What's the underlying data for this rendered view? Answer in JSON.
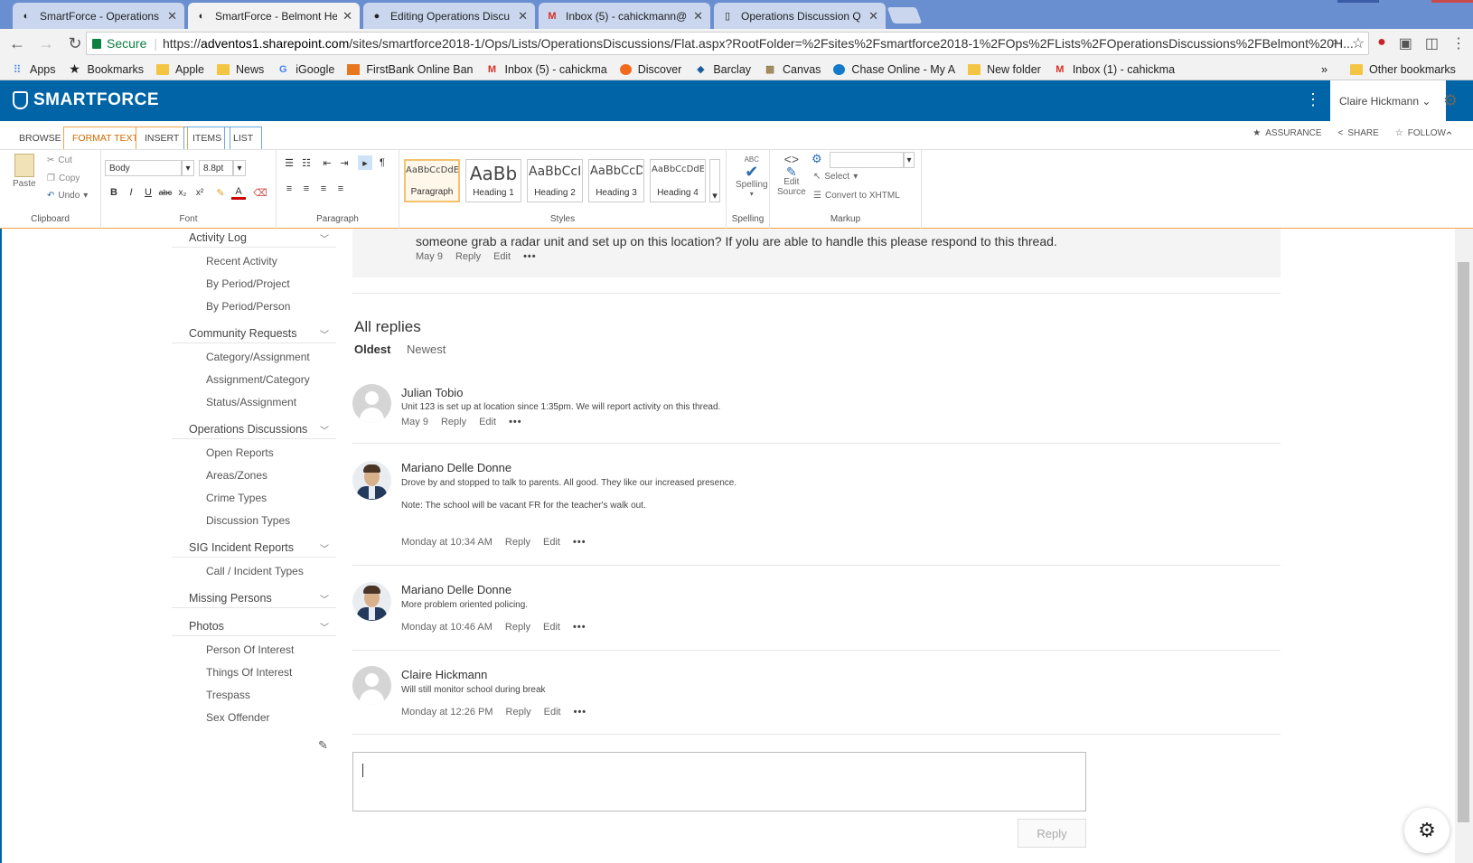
{
  "browser": {
    "tabs": [
      {
        "title": "SmartForce - Operations",
        "icon": "smartforce-icon"
      },
      {
        "title": "SmartForce - Belmont He",
        "icon": "smartforce-icon",
        "active": true
      },
      {
        "title": "Editing Operations Discu",
        "icon": "github-icon"
      },
      {
        "title": "Inbox (5) - cahickmann@",
        "icon": "gmail-icon"
      },
      {
        "title": "Operations Discussion Q",
        "icon": "document-icon"
      }
    ],
    "secure_label": "Secure",
    "url_prefix": "https://",
    "url_host": "adventos1.sharepoint.com",
    "url_path": "/sites/smartforce2018-1/Ops/Lists/OperationsDiscussions/Flat.aspx?RootFolder=%2Fsites%2Fsmartforce2018-1%2FOps%2FLists%2FOperationsDiscussions%2FBelmont%20H...",
    "bookmarks": [
      {
        "label": "Apps",
        "icon": "apps-grid-icon"
      },
      {
        "label": "Bookmarks",
        "icon": "star-icon"
      },
      {
        "label": "Apple",
        "icon": "folder-icon"
      },
      {
        "label": "News",
        "icon": "folder-icon"
      },
      {
        "label": "iGoogle",
        "icon": "google-icon"
      },
      {
        "label": "FirstBank Online Ban",
        "icon": "bank-icon"
      },
      {
        "label": "Inbox (5) - cahickma",
        "icon": "gmail-icon"
      },
      {
        "label": "Discover",
        "icon": "discover-icon"
      },
      {
        "label": "Barclay",
        "icon": "barclay-icon"
      },
      {
        "label": "Canvas",
        "icon": "canvas-icon"
      },
      {
        "label": "Chase Online - My A",
        "icon": "chase-icon"
      },
      {
        "label": "New folder",
        "icon": "folder-icon"
      },
      {
        "label": "Inbox (1) - cahickma",
        "icon": "gmail-icon"
      }
    ],
    "overflow_label": "»",
    "other_bookmarks": "Other bookmarks"
  },
  "suite": {
    "logo": "SMARTFORCE",
    "user": "Claire Hickmann",
    "user_chevron": "⌄"
  },
  "ribbon": {
    "tabs": [
      "BROWSE",
      "FORMAT TEXT",
      "INSERT",
      "ITEMS",
      "LIST"
    ],
    "links": [
      "ASSURANCE",
      "SHARE",
      "FOLLOW"
    ],
    "clipboard": {
      "paste": "Paste",
      "cut": "Cut",
      "copy": "Copy",
      "undo": "Undo",
      "label": "Clipboard"
    },
    "font": {
      "family": "Body",
      "size": "8.8pt",
      "label": "Font"
    },
    "paragraph_label": "Paragraph",
    "styles": [
      {
        "preview": "AaBbCcDdE",
        "name": "Paragraph",
        "selected": true
      },
      {
        "preview": "AaBb",
        "name": "Heading 1"
      },
      {
        "preview": "AaBbCcI",
        "name": "Heading 2"
      },
      {
        "preview": "AaBbCcD",
        "name": "Heading 3"
      },
      {
        "preview": "AaBbCcDdE",
        "name": "Heading 4"
      }
    ],
    "styles_label": "Styles",
    "spelling": {
      "abc": "ABC",
      "button": "Spelling",
      "label": "Spelling"
    },
    "markup": {
      "edit_source_1": "Edit",
      "edit_source_2": "Source",
      "select": "Select",
      "convert": "Convert to XHTML",
      "label": "Markup"
    }
  },
  "leftnav": {
    "sections": [
      {
        "title": "Activity Log",
        "items": [
          "Recent Activity",
          "By Period/Project",
          "By Period/Person"
        ]
      },
      {
        "title": "Community Requests",
        "items": [
          "Category/Assignment",
          "Assignment/Category",
          "Status/Assignment"
        ]
      },
      {
        "title": "Operations Discussions",
        "items": [
          "Open Reports",
          "Areas/Zones",
          "Crime Types",
          "Discussion Types"
        ]
      },
      {
        "title": "SIG Incident Reports",
        "items": [
          "Call / Incident Types"
        ]
      },
      {
        "title": "Missing Persons",
        "items": []
      },
      {
        "title": "Photos",
        "items": [
          "Person Of Interest",
          "Things Of Interest",
          "Trespass",
          "Sex Offender"
        ]
      }
    ]
  },
  "post": {
    "text": "someone grab a radar unit and set up on this location? If yolu are able to handle this please respond to this thread.",
    "date": "May 9",
    "reply": "Reply",
    "edit": "Edit",
    "more": "•••"
  },
  "replies_header": "All replies",
  "sort": {
    "oldest": "Oldest",
    "newest": "Newest"
  },
  "replies": [
    {
      "author": "Julian Tobio",
      "avatar": "blank",
      "lines": [
        "Unit 123 is set up at location since 1:35pm. We will report activity on this thread."
      ],
      "date": "May 9",
      "reply": "Reply",
      "edit": "Edit",
      "more": "•••"
    },
    {
      "author": "Mariano Delle Donne",
      "avatar": "photo",
      "lines": [
        "Drove by and stopped to talk to parents. All good. They like our increased presence.",
        "Note: The school will be vacant FR for the teacher's walk out."
      ],
      "date": "Monday at 10:34 AM",
      "reply": "Reply",
      "edit": "Edit",
      "more": "•••"
    },
    {
      "author": "Mariano Delle Donne",
      "avatar": "photo",
      "lines": [
        "More problem oriented policing."
      ],
      "date": "Monday at 10:46 AM",
      "reply": "Reply",
      "edit": "Edit",
      "more": "•••"
    },
    {
      "author": "Claire Hickmann",
      "avatar": "blank",
      "lines": [
        "Will still monitor school during break"
      ],
      "date": "Monday at 12:26 PM",
      "reply": "Reply",
      "edit": "Edit",
      "more": "•••"
    }
  ],
  "reply_button": "Reply"
}
